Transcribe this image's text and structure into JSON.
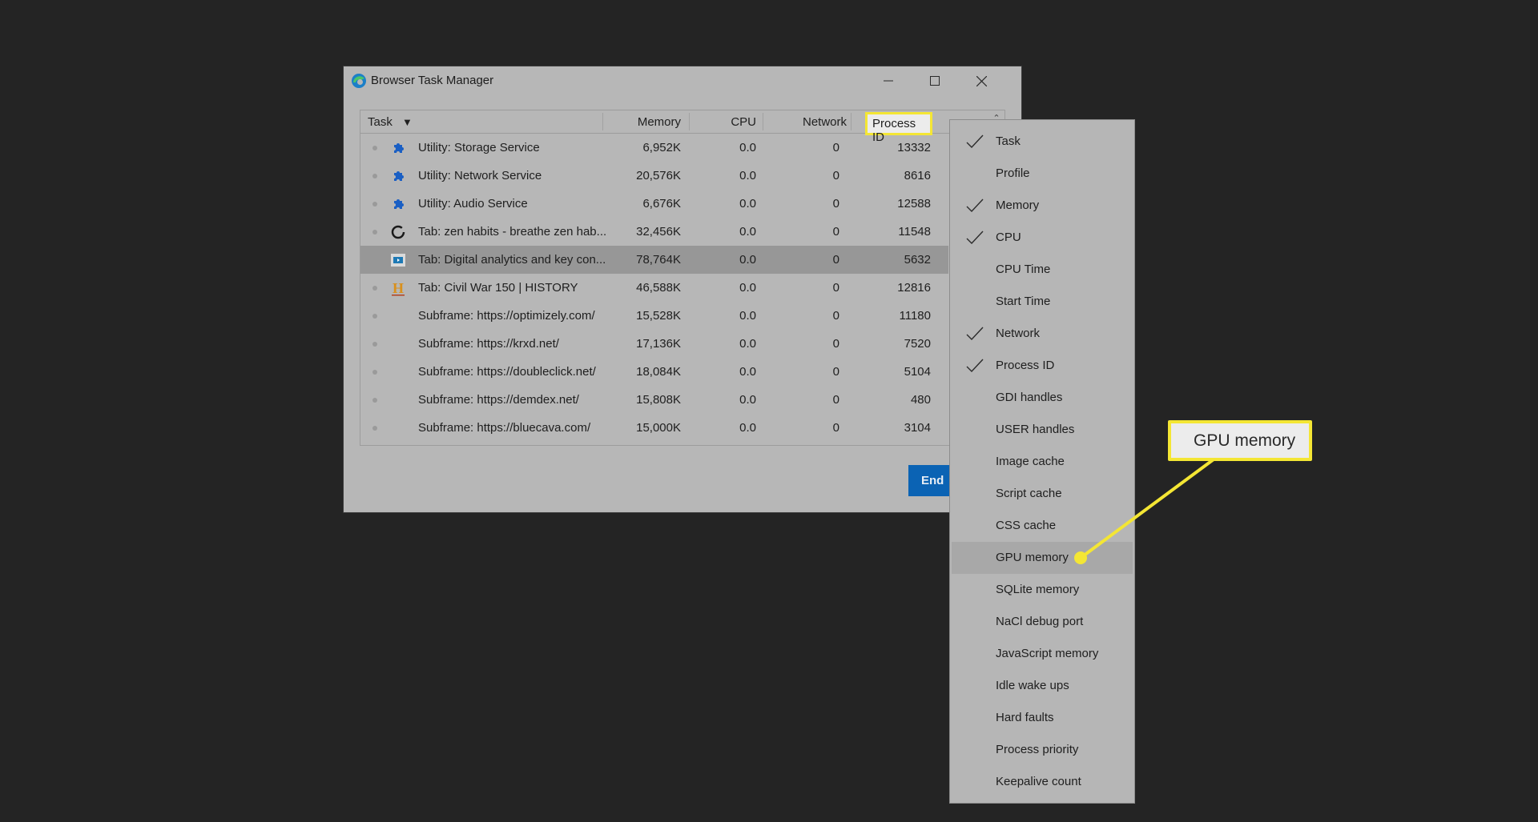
{
  "window": {
    "title": "Browser Task Manager",
    "controls": {
      "minimize": "minimize",
      "maximize": "maximize",
      "close": "close"
    }
  },
  "table": {
    "columns": {
      "task": "Task",
      "sort_indicator": "▼",
      "memory": "Memory",
      "cpu": "CPU",
      "network": "Network",
      "process_id": "Process ID"
    },
    "rows": [
      {
        "icon": "puzzle-piece-icon",
        "task": "Utility: Storage Service",
        "memory": "6,952K",
        "cpu": "0.0",
        "network": "0",
        "pid": "13332",
        "selected": false
      },
      {
        "icon": "puzzle-piece-icon",
        "task": "Utility: Network Service",
        "memory": "20,576K",
        "cpu": "0.0",
        "network": "0",
        "pid": "8616",
        "selected": false
      },
      {
        "icon": "puzzle-piece-icon",
        "task": "Utility: Audio Service",
        "memory": "6,676K",
        "cpu": "0.0",
        "network": "0",
        "pid": "12588",
        "selected": false
      },
      {
        "icon": "zen-habits-favicon",
        "task": "Tab: zen habits - breathe zen hab...",
        "memory": "32,456K",
        "cpu": "0.0",
        "network": "0",
        "pid": "11548",
        "selected": false
      },
      {
        "icon": "video-favicon",
        "task": "Tab: Digital analytics and key con...",
        "memory": "78,764K",
        "cpu": "0.0",
        "network": "0",
        "pid": "5632",
        "selected": true
      },
      {
        "icon": "history-favicon",
        "task": "Tab: Civil War 150 | HISTORY",
        "memory": "46,588K",
        "cpu": "0.0",
        "network": "0",
        "pid": "12816",
        "selected": false
      },
      {
        "icon": "",
        "task": "Subframe: https://optimizely.com/",
        "memory": "15,528K",
        "cpu": "0.0",
        "network": "0",
        "pid": "11180",
        "selected": false
      },
      {
        "icon": "",
        "task": "Subframe: https://krxd.net/",
        "memory": "17,136K",
        "cpu": "0.0",
        "network": "0",
        "pid": "7520",
        "selected": false
      },
      {
        "icon": "",
        "task": "Subframe: https://doubleclick.net/",
        "memory": "18,084K",
        "cpu": "0.0",
        "network": "0",
        "pid": "5104",
        "selected": false
      },
      {
        "icon": "",
        "task": "Subframe: https://demdex.net/",
        "memory": "15,808K",
        "cpu": "0.0",
        "network": "0",
        "pid": "480",
        "selected": false
      },
      {
        "icon": "",
        "task": "Subframe: https://bluecava.com/",
        "memory": "15,000K",
        "cpu": "0.0",
        "network": "0",
        "pid": "3104",
        "selected": false
      }
    ]
  },
  "end_button": {
    "label": "End"
  },
  "column_menu": {
    "items": [
      {
        "label": "Task",
        "checked": true
      },
      {
        "label": "Profile",
        "checked": false
      },
      {
        "label": "Memory",
        "checked": true
      },
      {
        "label": "CPU",
        "checked": true
      },
      {
        "label": "CPU Time",
        "checked": false
      },
      {
        "label": "Start Time",
        "checked": false
      },
      {
        "label": "Network",
        "checked": true
      },
      {
        "label": "Process ID",
        "checked": true
      },
      {
        "label": "GDI handles",
        "checked": false
      },
      {
        "label": "USER handles",
        "checked": false
      },
      {
        "label": "Image cache",
        "checked": false
      },
      {
        "label": "Script cache",
        "checked": false
      },
      {
        "label": "CSS cache",
        "checked": false
      },
      {
        "label": "GPU memory",
        "checked": false,
        "highlighted": true
      },
      {
        "label": "SQLite memory",
        "checked": false
      },
      {
        "label": "NaCl debug port",
        "checked": false
      },
      {
        "label": "JavaScript memory",
        "checked": false
      },
      {
        "label": "Idle wake ups",
        "checked": false
      },
      {
        "label": "Hard faults",
        "checked": false
      },
      {
        "label": "Process priority",
        "checked": false
      },
      {
        "label": "Keepalive count",
        "checked": false
      }
    ]
  },
  "annotations": {
    "header_highlight": "Process ID",
    "callout": "GPU memory",
    "highlight_color": "#f4e634"
  },
  "colors": {
    "background": "#242424",
    "window": "#b7b7b7",
    "selected_row": "#979797",
    "end_button": "#0b63b4",
    "puzzle_icon": "#1a5fc4",
    "history_icon": "#d9901c"
  }
}
